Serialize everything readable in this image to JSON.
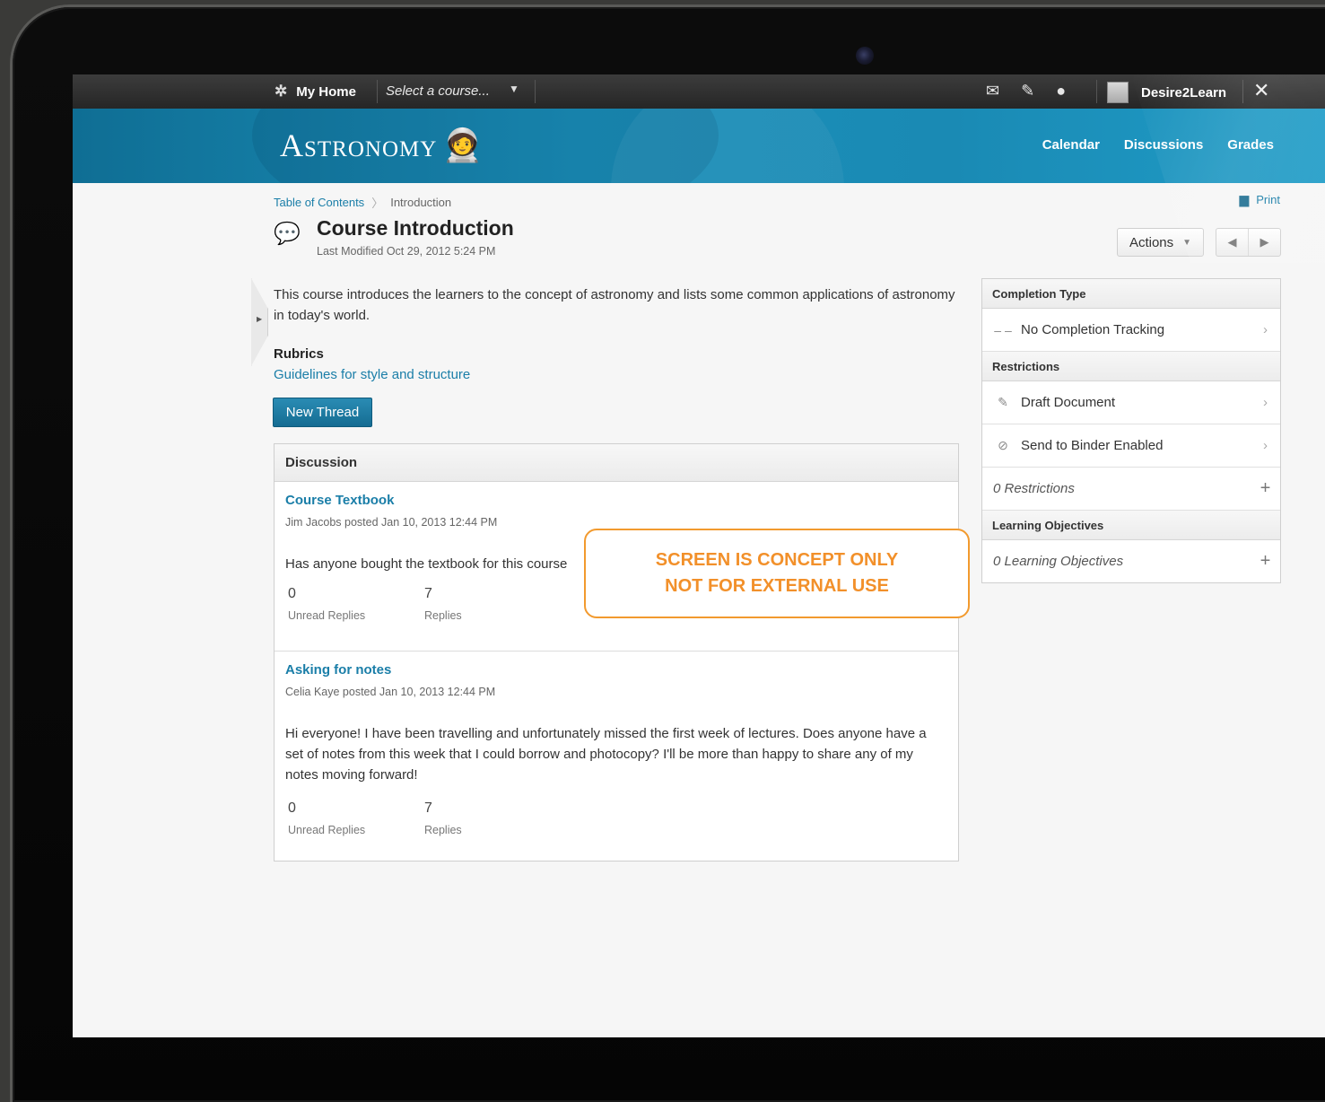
{
  "topbar": {
    "home_icon": "network-icon",
    "home_label": "My Home",
    "course_select": "Select a course...",
    "icons": [
      "mail-icon",
      "document-alert-icon",
      "chat-icon"
    ],
    "user_name": "Desire2Learn",
    "tools_icon": "tools-icon"
  },
  "banner": {
    "brand": "Astronomy",
    "nav": [
      "Calendar",
      "Discussions",
      "Grades"
    ]
  },
  "breadcrumb": {
    "root": "Table of Contents",
    "current": "Introduction"
  },
  "print_label": "Print",
  "page": {
    "title": "Course Introduction",
    "modified": "Last Modified Oct 29, 2012 5:24 PM",
    "description": "This course introduces the learners to the concept of astronomy and lists some common applications of astronomy in today's world.",
    "rubrics_heading": "Rubrics",
    "rubrics_link": "Guidelines for style and structure",
    "new_thread": "New Thread",
    "actions_label": "Actions"
  },
  "discussion": {
    "heading": "Discussion",
    "posts": [
      {
        "title": "Course Textbook",
        "meta": "Jim Jacobs posted Jan 10, 2013 12:44 PM",
        "body": "Has anyone bought the textbook for this course",
        "unread": "0",
        "unread_label": "Unread Replies",
        "replies": "7",
        "replies_label": "Replies"
      },
      {
        "title": "Asking for notes",
        "meta": "Celia Kaye posted Jan 10, 2013 12:44 PM",
        "body": "Hi everyone! I have been travelling and unfortunately missed the first week of lectures. Does anyone have a set of notes from this week that I could borrow and photocopy? I'll be more than happy to share any of my notes moving forward!",
        "unread": "0",
        "unread_label": "Unread Replies",
        "replies": "7",
        "replies_label": "Replies"
      }
    ]
  },
  "callout": {
    "line1": "SCREEN IS CONCEPT ONLY",
    "line2": "NOT FOR EXTERNAL USE"
  },
  "panel": {
    "completion_heading": "Completion Type",
    "completion_value": "No Completion Tracking",
    "restrictions_heading": "Restrictions",
    "draft": "Draft Document",
    "binder": "Send to Binder Enabled",
    "restrictions_count": "0 Restrictions",
    "objectives_heading": "Learning Objectives",
    "objectives_count": "0 Learning Objectives"
  }
}
